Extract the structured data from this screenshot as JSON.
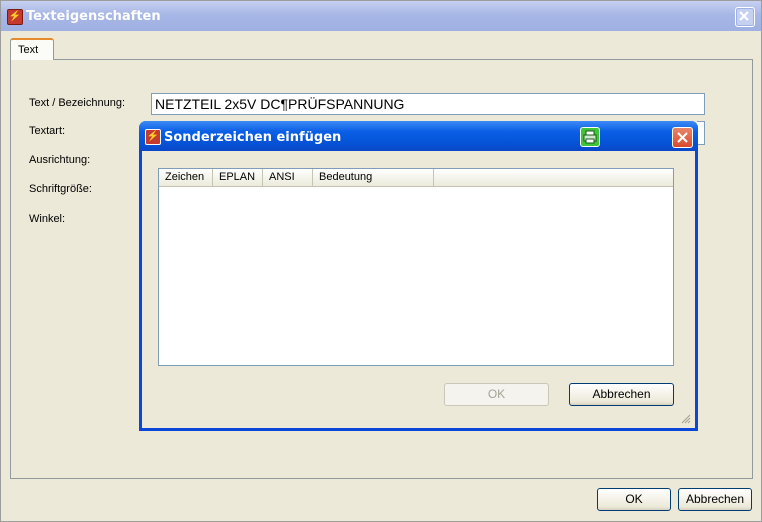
{
  "window": {
    "title": "Texteigenschaften",
    "tab": "Text",
    "labels": {
      "text": "Text / Bezeichnung:",
      "textart": "Textart:",
      "ausrichtung": "Ausrichtung:",
      "schriftgroesse": "Schriftgröße:",
      "winkel": "Winkel:"
    },
    "text_value": "NETZTEIL 2x5V DC¶PRÜFSPANNUNG",
    "ok": "OK",
    "cancel": "Abbrechen"
  },
  "dialog": {
    "title": "Sonderzeichen einfügen",
    "columns": [
      "Zeichen",
      "EPLAN",
      "ANSI",
      "Bedeutung"
    ],
    "rows": [],
    "ok": "OK",
    "cancel": "Abbrechen"
  },
  "colors": {
    "accent": "#0a46d8",
    "window_bg": "#ece9d8"
  },
  "icons": {
    "app": "eplan-app-icon",
    "print": "printer-icon",
    "close": "close-icon"
  }
}
